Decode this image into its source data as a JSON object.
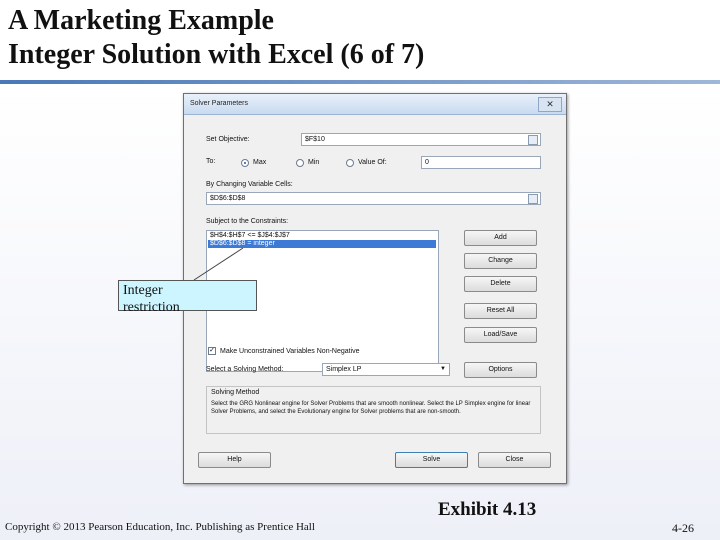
{
  "slide": {
    "title_line1": "A Marketing Example",
    "title_line2": "Integer Solution with Excel (6 of 7)",
    "exhibit": "Exhibit 4.13",
    "copyright": "Copyright © 2013 Pearson Education, Inc. Publishing as Prentice Hall",
    "page_number": "4-26",
    "accent_color": "#4a78b8"
  },
  "dialog": {
    "title": "Solver Parameters",
    "close_glyph": "✕",
    "set_objective_label": "Set Objective:",
    "set_objective_value": "$F$10",
    "to_label": "To:",
    "options": {
      "max": "Max",
      "min": "Min",
      "value_of": "Value Of:",
      "value_of_value": "0"
    },
    "selected_option": "max",
    "changing_cells_label": "By Changing Variable Cells:",
    "changing_cells_value": "$D$6:$D$8",
    "constraints_label": "Subject to the Constraints:",
    "constraints": [
      "$H$4:$H$7 <= $J$4:$J$7",
      "$D$6:$D$8 = integer"
    ],
    "selected_constraint_index": 1,
    "buttons": {
      "add": "Add",
      "change": "Change",
      "delete": "Delete",
      "reset_all": "Reset All",
      "load_save": "Load/Save",
      "options": "Options",
      "help": "Help",
      "solve": "Solve",
      "close": "Close"
    },
    "nonnegative_label": "Make Unconstrained Variables Non-Negative",
    "nonnegative_checked": true,
    "check_glyph": "✓",
    "solving_method_label": "Select a Solving Method:",
    "solving_method_value": "Simplex LP",
    "dropdown_glyph": "▼",
    "solving_method_group_title": "Solving Method",
    "solving_method_description": "Select the GRG Nonlinear engine for Solver Problems that are smooth nonlinear. Select the LP Simplex engine for linear Solver Problems, and select the Evolutionary engine for Solver problems that are non-smooth."
  },
  "callout": {
    "line1": "Integer",
    "line2": "restriction",
    "fill_color": "#ccf5ff"
  }
}
